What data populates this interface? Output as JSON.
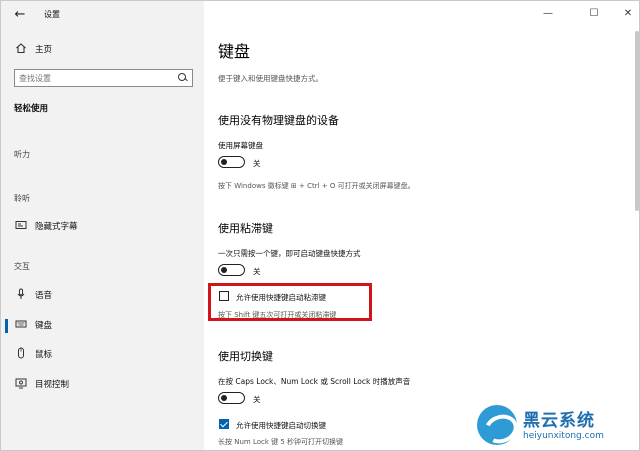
{
  "window": {
    "title": "设置"
  },
  "sidebar": {
    "home_label": "主页",
    "search_placeholder": "查找设置",
    "category_title": "轻松使用",
    "groups": {
      "vision": "听力",
      "hearing": "聆听",
      "interaction": "交互"
    },
    "items": {
      "captions": "隐藏式字幕",
      "speech": "语音",
      "keyboard": "键盘",
      "mouse": "鼠标",
      "eye_control": "目视控制"
    }
  },
  "main": {
    "title": "键盘",
    "description": "便于键入和使用键盘快捷方式。",
    "section1": {
      "title": "使用没有物理键盘的设备",
      "item_label": "使用屏幕键盘",
      "toggle_state": "关",
      "hint": "按下 Windows 徽标键 ⊞ + Ctrl + O 可打开或关闭屏幕键盘。"
    },
    "section2": {
      "title": "使用粘滞键",
      "item_label": "一次只需按一个键，即可启动键盘快捷方式",
      "toggle_state": "关",
      "checkbox_label": "允许使用快捷键启动粘滞键",
      "checkbox_checked": false,
      "hint": "按下 Shift 键五次可打开或关闭粘滞键"
    },
    "section3": {
      "title": "使用切换键",
      "item_label": "在按 Caps Lock、Num Lock 或 Scroll Lock 时播放声音",
      "toggle_state": "关",
      "checkbox_label": "允许使用快捷键启动切换键",
      "checkbox_checked": true,
      "hint": "长按 Num Lock 键 5 秒钟可打开切换键"
    }
  },
  "watermark": {
    "title": "黑云系统",
    "subtitle": "heiyunxitong.com"
  },
  "colors": {
    "accent": "#0063b1",
    "highlight_border": "#d0141b",
    "sidebar_bg": "#f2f2f2"
  }
}
